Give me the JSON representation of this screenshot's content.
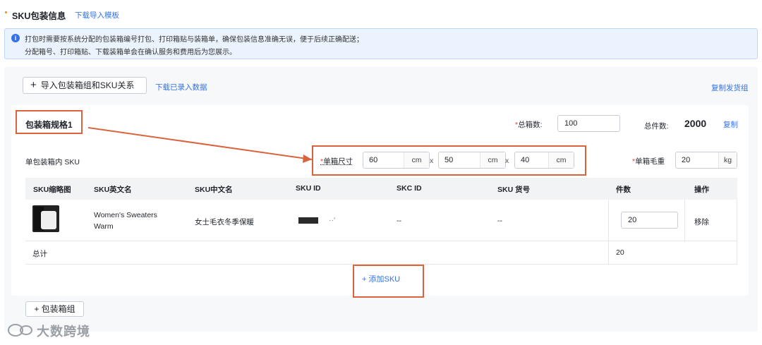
{
  "header": {
    "title": "SKU包装信息",
    "template_link": "下载导入模板"
  },
  "notice": {
    "line1": "打包时需要按系统分配的包装箱编号打包、打印箱贴与装箱单，确保包装信息准确无误，便于后续正确配送；",
    "line2": "分配箱号、打印箱贴、下载装箱单会在确认服务和费用后为您展示。"
  },
  "toolbar": {
    "import_button": "导入包装箱组和SKU关系",
    "download_link": "下载已录入数据",
    "copy_group_link": "复制发货组"
  },
  "box": {
    "spec_title": "包装箱规格1",
    "total_boxes_label": "总箱数:",
    "total_boxes_value": "100",
    "total_pcs_label": "总件数:",
    "total_pcs_value": "2000",
    "copy_link": "复制",
    "sku_inner_label": "单包装箱内 SKU",
    "size_label": "单箱尺寸",
    "length": "60",
    "width": "50",
    "height": "40",
    "unit_cm": "cm",
    "x_sign": "x",
    "weight_label": "单箱毛重",
    "weight_value": "20",
    "unit_kg": "kg",
    "required_mark": "*"
  },
  "table": {
    "headers": [
      "SKU缩略图",
      "SKU英文名",
      "SKU中文名",
      "SKU ID",
      "SKC ID",
      "SKU 货号",
      "件数",
      "操作"
    ],
    "rows": [
      {
        "en_name_1": "Women's Sweaters",
        "en_name_2": "Warm",
        "cn_name": "女士毛衣冬季保暖",
        "sku_id_suffix": "··‘",
        "skc_id": "--",
        "sku_no": "--",
        "qty": "20",
        "action": "移除"
      }
    ],
    "total_label": "总计",
    "total_qty": "20",
    "add_sku": "+ 添加SKU"
  },
  "add_box_button": "+ 包装箱组",
  "watermark": {
    "logo_text": "大数跨境",
    "logo_icon": "chat-bubble-icon"
  },
  "colors": {
    "link": "#3372e8",
    "required": "#e5413d",
    "highlight": "#d9633c",
    "accent_dot": "#f08a24"
  }
}
